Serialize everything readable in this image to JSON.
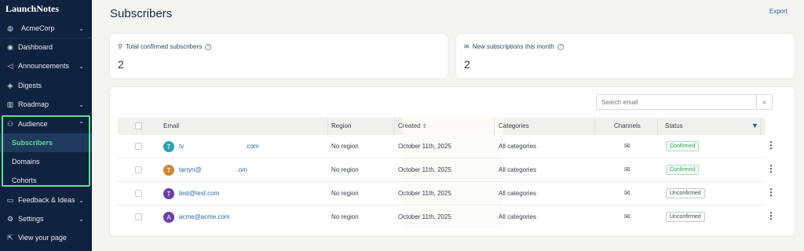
{
  "app": {
    "logo": "LaunchNotes"
  },
  "sidebar": {
    "workspace": {
      "label": "AcmeCorp",
      "icon": "globe-icon"
    },
    "items": [
      {
        "label": "Dashboard",
        "icon": "dashboard-icon"
      },
      {
        "label": "Announcements",
        "icon": "megaphone-icon"
      },
      {
        "label": "Digests",
        "icon": "layers-icon"
      },
      {
        "label": "Roadmap",
        "icon": "map-icon"
      },
      {
        "label": "Audience",
        "icon": "users-icon"
      },
      {
        "label": "Feedback & Ideas",
        "icon": "chat-icon"
      },
      {
        "label": "Settings",
        "icon": "gear-icon"
      },
      {
        "label": "View your page",
        "icon": "external-link-icon"
      }
    ],
    "audience_sub": [
      "Subscribers",
      "Domains",
      "Cohorts"
    ],
    "highlight_color": "#5ee08c"
  },
  "header": {
    "title": "Subscribers",
    "export_label": "Export"
  },
  "stats": {
    "total_label": "Total confirmed subscribers",
    "total_value": "2",
    "new_label": "New subscriptions this month",
    "new_value": "2"
  },
  "search": {
    "placeholder": "Search email"
  },
  "table": {
    "columns": {
      "email": "Email",
      "region": "Region",
      "created": "Created",
      "categories": "Categories",
      "channels": "Channels",
      "status": "Status"
    },
    "rows": [
      {
        "initial": "T",
        "avatar_color": "#2aa2b8",
        "email_visible_start": "tv",
        "email_visible_end": ".com",
        "region": "No region",
        "created": "October 11th, 2025",
        "categories": "All categories",
        "status": "Confirmed",
        "status_color": "#3fa66b"
      },
      {
        "initial": "T",
        "avatar_color": "#d08a35",
        "email_visible_start": "tarryn@",
        "email_visible_end": ".om",
        "region": "No region",
        "created": "October 11th, 2025",
        "categories": "All categories",
        "status": "Confirmed",
        "status_color": "#3fa66b"
      },
      {
        "initial": "T",
        "avatar_color": "#6a3fa6",
        "email_visible_start": "test@test.com",
        "email_visible_end": "",
        "region": "No region",
        "created": "October 11th, 2025",
        "categories": "All categories",
        "status": "Unconfirmed",
        "status_color": "#4a4f55"
      },
      {
        "initial": "A",
        "avatar_color": "#6a3fa6",
        "email_visible_start": "acme@acme.com",
        "email_visible_end": "",
        "region": "No region",
        "created": "October 11th, 2025",
        "categories": "All categories",
        "status": "Unconfirmed",
        "status_color": "#4a4f55"
      }
    ]
  }
}
